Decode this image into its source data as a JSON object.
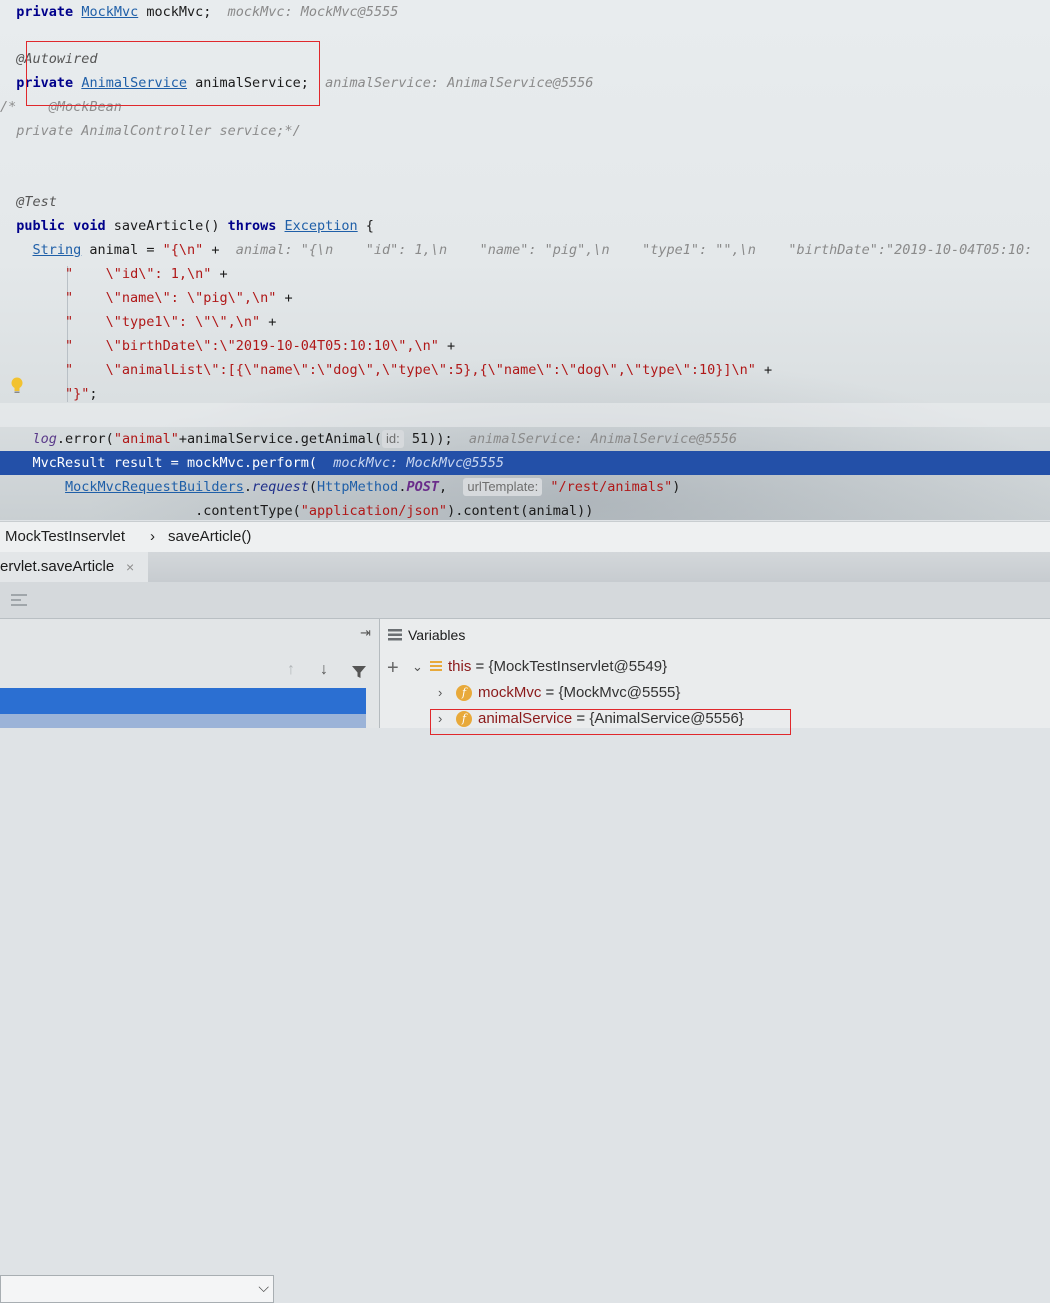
{
  "code": {
    "l0": {
      "kw": "private",
      "type": "MockMvc",
      "rest": " mockMvc;",
      "hint": "mockMvc: MockMvc@5555"
    },
    "l1": {
      "ann": "@Autowired"
    },
    "l2": {
      "kw": "private",
      "type": "AnimalService",
      "rest": " animalService;",
      "hint": "animalService: AnimalService@5556"
    },
    "l3": {
      "cmt": "/*    @MockBean"
    },
    "l4": {
      "cmt": "private AnimalController service;*/"
    },
    "l5": {
      "ann": "@Test"
    },
    "l6": {
      "kw1": "public void",
      "name": " saveArticle() ",
      "kw2": "throws",
      "type": "Exception",
      "rest": " {"
    },
    "l7": {
      "type": "String",
      "rest": " animal = ",
      "str": "\"{\\n\"",
      "plus": " + ",
      "hint": "animal: \"{\\n    \"id\": 1,\\n    \"name\": \"pig\",\\n    \"type1\": \"\",\\n    \"birthDate\":\"2019-10-04T05:10:"
    },
    "l8": {
      "str1": "\"    \\\"",
      "txt": "id",
      "str2": "\\\": 1,\\n\"",
      "plus": " +"
    },
    "l9": {
      "str": "\"    \\\"name\\\": \\\"pig\\\",\\n\"",
      "plus": " +"
    },
    "l10": {
      "str": "\"    \\\"type1\\\": \\\"\\\",\\n\"",
      "plus": " +"
    },
    "l11": {
      "str": "\"    \\\"birthDate\\\":\\\"2019-10-04T05:10:10\\\",\\n\"",
      "plus": " +"
    },
    "l12": {
      "str": "\"    \\\"animalList\\\":[{\\\"name\\\":\\\"dog\\\",\\\"type\\\":5},{\\\"name\\\":\\\"dog\\\",\\\"type\\\":10}]\\n\"",
      "plus": " +"
    },
    "l13": {
      "str": "\"}\"",
      "rest": ";"
    },
    "l14": {
      "log": "log",
      "rest1": ".error(",
      "str": "\"animal\"",
      "rest2": "+animalService.getAnimal(",
      "inlay": "id:",
      "num": "51",
      "rest3": "));",
      "hint": "animalService: AnimalService@5556"
    },
    "l15": {
      "rest": "MvcResult result = mockMvc.perform(",
      "hint": "mockMvc: MockMvc@5555"
    },
    "l16": {
      "type": "MockMvcRequestBuilders",
      "dot": ".",
      "meth": "request",
      "p1": "(",
      "cls": "HttpMethod",
      "dot2": ".",
      "fld": "POST",
      "comma": ", ",
      "inlay": "urlTemplate:",
      "str": "\"/rest/animals\"",
      "close": ")"
    },
    "l17": {
      "rest1": ".contentType(",
      "str": "\"application/json\"",
      "rest2": ").content(animal))"
    }
  },
  "breadcrumb": {
    "class": "MockTestInservlet",
    "sep": "›",
    "method": "saveArticle()"
  },
  "tab": {
    "label": "ervlet.saveArticle",
    "close": "×"
  },
  "debug": {
    "variables_title": "Variables",
    "vars": [
      {
        "name": "this",
        "value": "{MockTestInservlet@5549}"
      },
      {
        "name": "mockMvc",
        "value": "{MockMvc@5555}"
      },
      {
        "name": "animalService",
        "value": "{AnimalService@5556}"
      }
    ]
  },
  "colors": {
    "highlight": "#2350a8",
    "redbox": "#e0282c",
    "frame_selected": "#2b6fd2"
  }
}
